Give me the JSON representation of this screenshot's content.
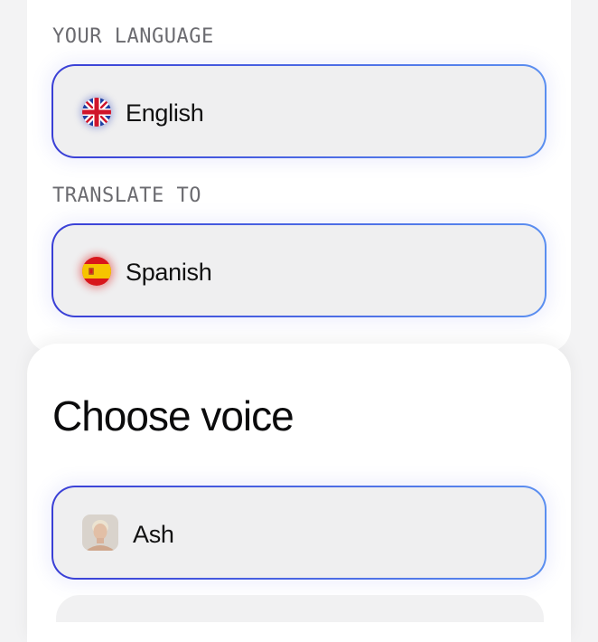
{
  "language_section": {
    "label": "YOUR LANGUAGE",
    "selected": {
      "name": "English",
      "flag_icon": "uk-flag-icon"
    }
  },
  "translate_section": {
    "label": "TRANSLATE TO",
    "selected": {
      "name": "Spanish",
      "flag_icon": "spain-flag-icon"
    }
  },
  "voice_section": {
    "title": "Choose voice",
    "voices": [
      {
        "name": "Ash",
        "avatar": "ash-avatar"
      }
    ]
  },
  "colors": {
    "border_start": "#3a3fd6",
    "border_end": "#5b8ff0",
    "field_bg": "#efeff0",
    "label_gray": "#6b6b70"
  }
}
